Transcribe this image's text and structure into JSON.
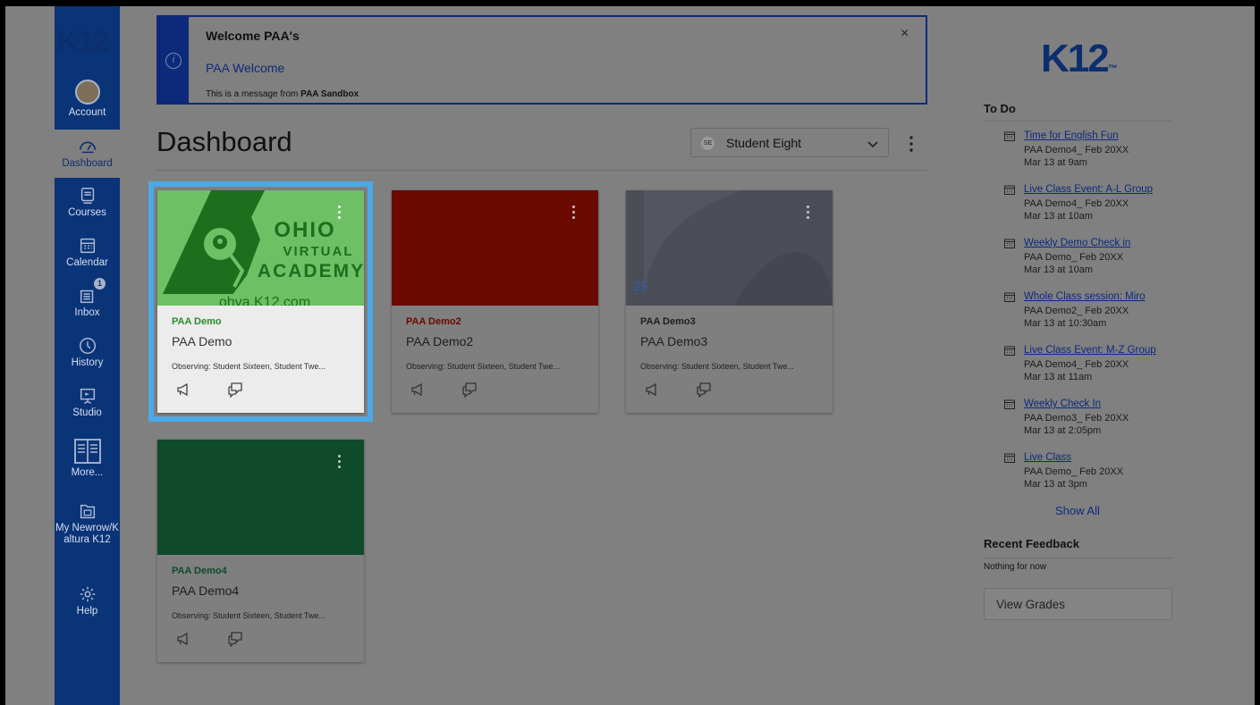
{
  "brand": {
    "logo_text": "K12",
    "logo_tm": "™"
  },
  "nav": {
    "account": "Account",
    "dashboard": "Dashboard",
    "courses": "Courses",
    "calendar": "Calendar",
    "inbox": "Inbox",
    "inbox_badge": "1",
    "history": "History",
    "studio": "Studio",
    "more": "More...",
    "myapp": "My Newrow/Kaltura K12",
    "help": "Help"
  },
  "banner": {
    "title": "Welcome PAA's",
    "link": "PAA Welcome",
    "msg_prefix": "This is a message from ",
    "msg_source": "PAA Sandbox",
    "close": "×"
  },
  "header": {
    "title": "Dashboard",
    "observer_initials": "SE",
    "observer_name": "Student Eight"
  },
  "cards": [
    {
      "code": "PAA Demo",
      "name": "PAA Demo",
      "observing": "Observing: Student Sixteen, Student Twe...",
      "color": "#2a8a2a",
      "hero": {
        "line1": "OHIO",
        "line2": "VIRTUAL",
        "line3": "ACADEMY",
        "url": "ohva.K12.com"
      }
    },
    {
      "code": "PAA Demo2",
      "name": "PAA Demo2",
      "observing": "Observing: Student Sixteen, Student Twe...",
      "color": "#6b0a00"
    },
    {
      "code": "PAA Demo3",
      "name": "PAA Demo3",
      "observing": "Observing: Student Sixteen, Student Twe...",
      "color": "#4b4e57",
      "hero_mark": "25"
    },
    {
      "code": "PAA Demo4",
      "name": "PAA Demo4",
      "observing": "Observing: Student Sixteen, Student Twe...",
      "color": "#0f4a2a"
    }
  ],
  "todo": {
    "heading": "To Do",
    "items": [
      {
        "title": "Time for English Fun",
        "course": "PAA Demo4_ Feb 20XX",
        "date": "Mar 13 at 9am"
      },
      {
        "title": "Live Class Event: A-L Group",
        "course": "PAA Demo4_ Feb 20XX",
        "date": "Mar 13 at 10am"
      },
      {
        "title": "Weekly Demo Check in",
        "course": "PAA Demo_ Feb 20XX",
        "date": "Mar 13 at 10am"
      },
      {
        "title": "Whole Class session: Miro",
        "course": "PAA Demo2_ Feb 20XX",
        "date": "Mar 13 at 10:30am"
      },
      {
        "title": "Live Class Event: M-Z Group",
        "course": "PAA Demo4_ Feb 20XX",
        "date": "Mar 13 at 11am"
      },
      {
        "title": "Weekly Check In",
        "course": "PAA Demo3_ Feb 20XX",
        "date": "Mar 13 at 2:05pm"
      },
      {
        "title": "Live Class",
        "course": "PAA Demo_ Feb 20XX",
        "date": "Mar 13 at 3pm"
      }
    ],
    "show_all": "Show All"
  },
  "feedback": {
    "heading": "Recent Feedback",
    "empty": "Nothing for now",
    "view_grades": "View Grades"
  },
  "colors": {
    "nav_bg": "#0a3478",
    "selected_outline": "#4aa9e6",
    "link": "#0b2a7e"
  }
}
